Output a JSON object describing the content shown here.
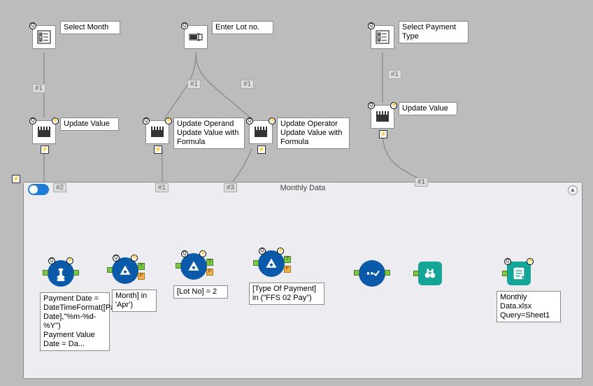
{
  "interface_tools": {
    "select_month": {
      "label": "Select Month"
    },
    "enter_lot": {
      "label": "Enter Lot no."
    },
    "select_payment": {
      "label": "Select Payment Type"
    }
  },
  "actions": {
    "update_value_1": {
      "label": "Update Value"
    },
    "update_operand": {
      "label": "Update Operand Update Value with Formula"
    },
    "update_operator": {
      "label": "Update Operator Update Value with Formula"
    },
    "update_value_2": {
      "label": "Update Value"
    }
  },
  "connectors": {
    "c1": "#1",
    "c2": "#2",
    "c3": "#3"
  },
  "container": {
    "title": "Monthly Data"
  },
  "workflow": {
    "formula": {
      "annotation": "Payment Date = DateTimeFormat([Payment Date],\"%m-%d-%Y\")\nPayment Value Date = Da..."
    },
    "filter_month": {
      "annotation": "Month] in 'Apr')"
    },
    "filter_lot": {
      "annotation": "[Lot No] = 2"
    },
    "filter_payment": {
      "annotation": "[Type Of Payment] in (\"FFS 02 Pay\")"
    },
    "output": {
      "annotation": "Monthly Data.xlsx Query=Sheet1"
    }
  },
  "glyphs": {
    "q": "Q",
    "bolt": "⚡",
    "true": "T",
    "false": "F"
  }
}
